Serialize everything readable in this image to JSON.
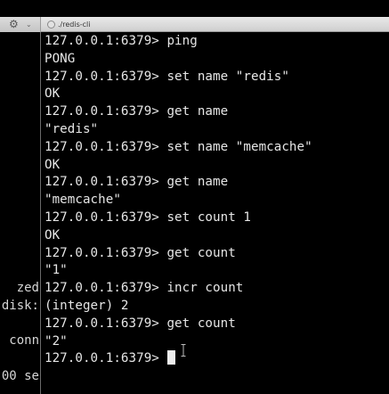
{
  "window": {
    "tab_title": "./redis-cli",
    "settings_icon": "gear-icon",
    "close_icon": "close-icon"
  },
  "left_pane": {
    "lines": [
      {
        "text": "zed"
      },
      {
        "text": "disk:"
      },
      {
        "text": "conn"
      },
      {
        "text": "00 se"
      }
    ]
  },
  "terminal": {
    "lines": [
      {
        "text": "127.0.0.1:6379> ping"
      },
      {
        "text": "PONG"
      },
      {
        "text": "127.0.0.1:6379> set name \"redis\""
      },
      {
        "text": "OK"
      },
      {
        "text": "127.0.0.1:6379> get name"
      },
      {
        "text": "\"redis\""
      },
      {
        "text": "127.0.0.1:6379> set name \"memcache\""
      },
      {
        "text": "OK"
      },
      {
        "text": "127.0.0.1:6379> get name"
      },
      {
        "text": "\"memcache\""
      },
      {
        "text": "127.0.0.1:6379> set count 1"
      },
      {
        "text": "OK"
      },
      {
        "text": "127.0.0.1:6379> get count"
      },
      {
        "text": "\"1\""
      },
      {
        "text": "127.0.0.1:6379> incr count"
      },
      {
        "text": "(integer) 2"
      },
      {
        "text": "127.0.0.1:6379> get count"
      },
      {
        "text": "\"2\""
      }
    ],
    "prompt": "127.0.0.1:6379>"
  }
}
